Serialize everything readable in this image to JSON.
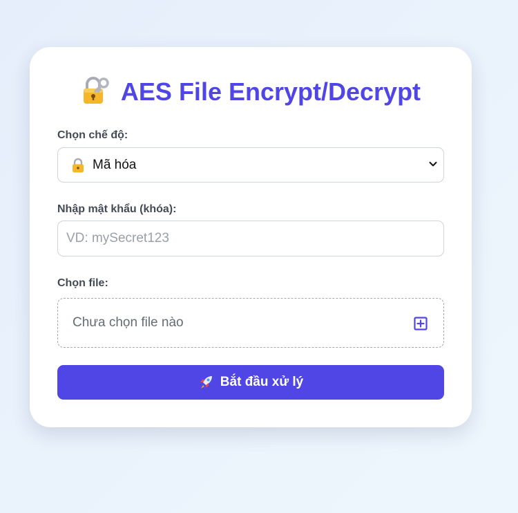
{
  "header": {
    "title": "AES File Encrypt/Decrypt",
    "title_icon": "lock-with-key-icon"
  },
  "mode": {
    "label": "Chọn chế độ:",
    "selected": "Mã hóa",
    "selected_icon": "locked-padlock-icon"
  },
  "password": {
    "label": "Nhập mật khẩu (khóa):",
    "value": "",
    "placeholder": "VD: mySecret123"
  },
  "file": {
    "label": "Chọn file:",
    "status": "Chưa chọn file nào"
  },
  "submit": {
    "label": "Bắt đầu xử lý",
    "icon": "rocket-icon"
  },
  "colors": {
    "accent": "#4f46e5",
    "card_bg": "#ffffff",
    "page_bg": "#e9f1fc"
  }
}
